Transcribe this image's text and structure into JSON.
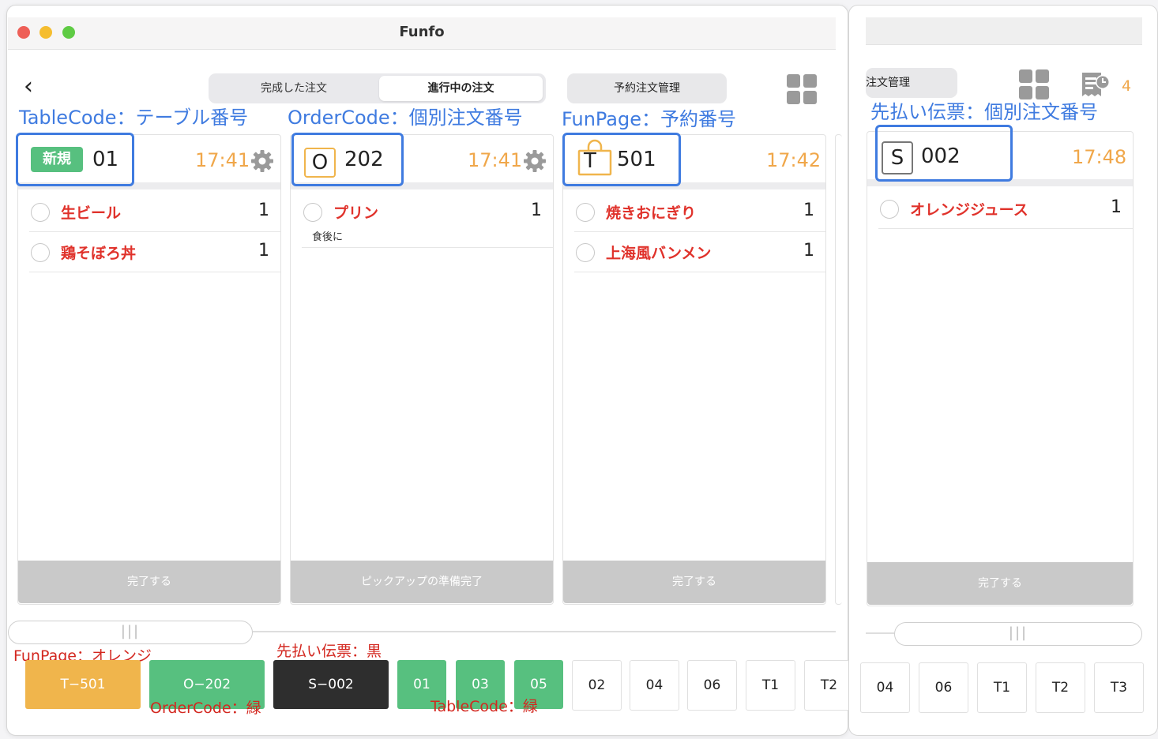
{
  "window": {
    "title": "Funfo"
  },
  "tabs": {
    "completed": "完成した注文",
    "in_progress": "進行中の注文",
    "reservation": "予約注文管理",
    "reservation_cut": "注文管理"
  },
  "annotations": {
    "tablecode": "TableCode：テーブル番号",
    "ordercode": "OrderCode：個別注文番号",
    "funpage": "FunPage：予約番号",
    "prepaid": "先払い伝票：個別注文番号",
    "funpage_color": "FunPage：オレンジ",
    "ordercode_color": "OrderCode：緑",
    "prepaid_color": "先払い伝票：黒",
    "tablecode_color": "TableCode：緑"
  },
  "cards": [
    {
      "badge": "新規",
      "code_prefix": "",
      "code": "01",
      "time": "17:41",
      "items": [
        {
          "name": "生ビール",
          "qty": "1"
        },
        {
          "name": "鶏そぼろ丼",
          "qty": "1"
        }
      ],
      "footer": "完了する"
    },
    {
      "badge": "",
      "code_prefix": "O",
      "code": "202",
      "time": "17:41",
      "items": [
        {
          "name": "プリン",
          "qty": "1",
          "note": "食後に"
        }
      ],
      "footer": "ピックアップの準備完了"
    },
    {
      "badge": "",
      "code_prefix": "T",
      "code": "501",
      "time": "17:42",
      "items": [
        {
          "name": "焼きおにぎり",
          "qty": "1"
        },
        {
          "name": "上海風バンメン",
          "qty": "1"
        }
      ],
      "footer": "完了する"
    },
    {
      "badge": "",
      "code_prefix": "S",
      "code": "002",
      "time": "17:48",
      "items": [
        {
          "name": "オレンジジュース",
          "qty": "1"
        }
      ],
      "footer": "完了する"
    }
  ],
  "badge_count": "4",
  "scroll_label": "|||",
  "bottom_tabs": [
    "T−501",
    "O−202",
    "S−002",
    "01",
    "03",
    "05",
    "02",
    "04",
    "06",
    "T1",
    "T2"
  ],
  "bottom_tabs_right": [
    "04",
    "06",
    "T1",
    "T2",
    "T3"
  ],
  "colors": {
    "accent_blue": "#3f7be0",
    "orange": "#f0b54c",
    "green": "#57c07f",
    "black": "#2e2e2e",
    "red": "#e0322b",
    "time": "#f0a74a"
  },
  "icons": [
    "back-chevron-icon",
    "grid-icon",
    "gear-icon",
    "shopping-bag-icon",
    "receipt-clock-icon"
  ]
}
